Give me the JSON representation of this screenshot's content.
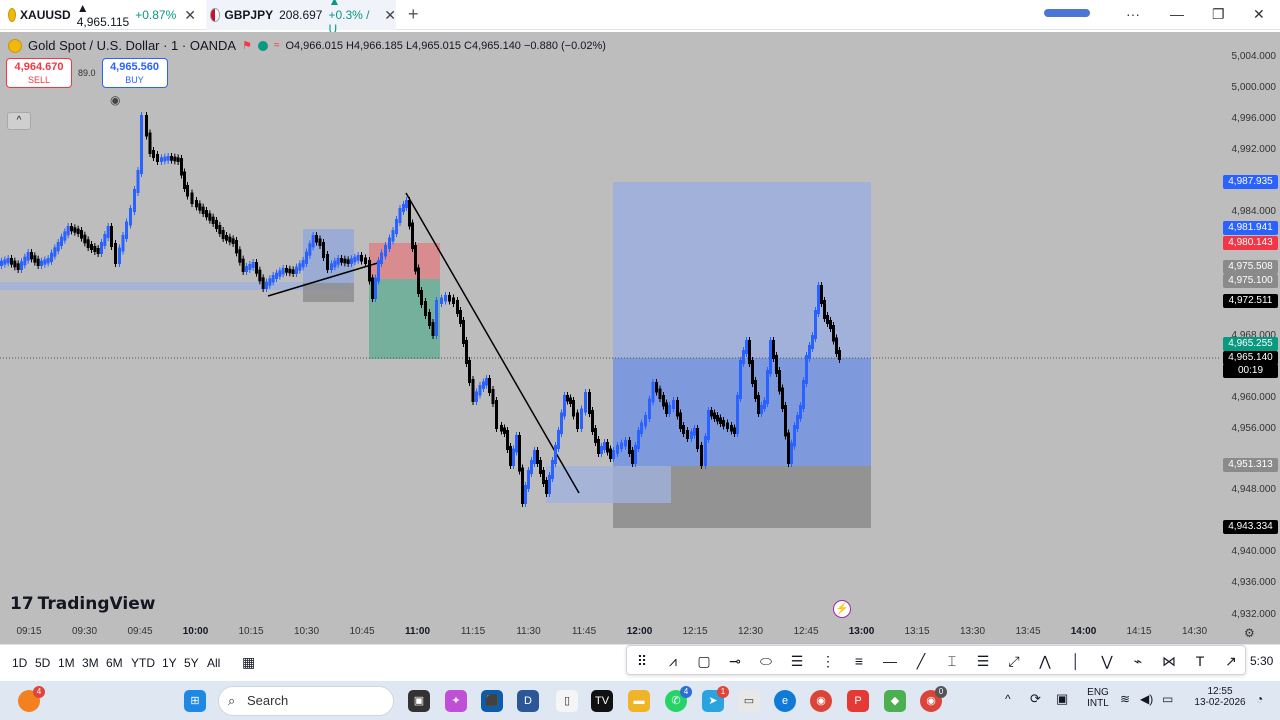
{
  "tabs": [
    {
      "symbol": "XAUUSD",
      "price": "▲ 4,965.115",
      "change": "+0.87%",
      "close": "✕",
      "icon": "gold-coin-icon"
    },
    {
      "symbol": "GBPJPY",
      "price": "208.697",
      "change": "▲ +0.3% / U",
      "close": "✕",
      "icon": "flag-icon"
    }
  ],
  "new_tab": "+",
  "window_controls": {
    "menu": "···",
    "minimize": "—",
    "restore": "❐",
    "close": "✕"
  },
  "legend": {
    "title": "Gold Spot / U.S. Dollar · 1 · OANDA",
    "ohlc": "O4,966.015  H4,966.185  L4,965.015  C4,965.140  −0.880 (−0.02%)"
  },
  "trade": {
    "sell_price": "4,964.670",
    "sell_label": "SELL",
    "spread": "89.0",
    "buy_price": "4,965.560",
    "buy_label": "BUY",
    "collapse": "^"
  },
  "logo": {
    "mark": "17",
    "text": "TradingView"
  },
  "price_axis": [
    "5,004.000",
    "5,000.000",
    "4,996.000",
    "4,992.000",
    "4,984.000",
    "4,968.000",
    "4,960.000",
    "4,956.000",
    "4,948.000",
    "4,940.000",
    "4,936.000",
    "4,932.000"
  ],
  "price_tags": [
    {
      "text": "4,987.935",
      "color": "#2962ff"
    },
    {
      "text": "4,981.941",
      "color": "#2962ff"
    },
    {
      "text": "4,980.143",
      "color": "#f23645"
    },
    {
      "text": "4,975.508",
      "color": "#8a8a8a"
    },
    {
      "text": "4,975.100",
      "color": "#8a8a8a"
    },
    {
      "text": "4,972.511",
      "color": "#000000"
    },
    {
      "text": "4,965.255",
      "color": "#089981"
    },
    {
      "text": "4,965.140",
      "color": "#000000"
    },
    {
      "text": "00:19",
      "color": "#000000"
    },
    {
      "text": "4,951.313",
      "color": "#8a8a8a"
    },
    {
      "text": "4,943.334",
      "color": "#000000"
    }
  ],
  "time_axis": [
    {
      "t": "09:15",
      "bold": false
    },
    {
      "t": "09:30",
      "bold": false
    },
    {
      "t": "09:45",
      "bold": false
    },
    {
      "t": "10:00",
      "bold": true
    },
    {
      "t": "10:15",
      "bold": false
    },
    {
      "t": "10:30",
      "bold": false
    },
    {
      "t": "10:45",
      "bold": false
    },
    {
      "t": "11:00",
      "bold": true
    },
    {
      "t": "11:15",
      "bold": false
    },
    {
      "t": "11:30",
      "bold": false
    },
    {
      "t": "11:45",
      "bold": false
    },
    {
      "t": "12:00",
      "bold": true
    },
    {
      "t": "12:15",
      "bold": false
    },
    {
      "t": "12:30",
      "bold": false
    },
    {
      "t": "12:45",
      "bold": false
    },
    {
      "t": "13:00",
      "bold": true
    },
    {
      "t": "13:15",
      "bold": false
    },
    {
      "t": "13:30",
      "bold": false
    },
    {
      "t": "13:45",
      "bold": false
    },
    {
      "t": "14:00",
      "bold": true
    },
    {
      "t": "14:15",
      "bold": false
    },
    {
      "t": "14:30",
      "bold": false
    }
  ],
  "ranges": [
    "1D",
    "5D",
    "1M",
    "3M",
    "6M",
    "YTD",
    "1Y",
    "5Y",
    "All"
  ],
  "bottom_clock": "5:30",
  "drawing_tools": [
    "⠿",
    "⩘",
    "▢",
    "⊸",
    "⬭",
    "☰",
    "⋮",
    "≡",
    "—",
    "╱",
    "⌶",
    "☰",
    "⤢",
    "⋀",
    "│",
    "⋁",
    "⌁",
    "⋈",
    "T",
    "↗"
  ],
  "taskbar": {
    "search_placeholder": "Search",
    "language": "ENG",
    "language_sub": "INTL",
    "time": "12:55",
    "date": "13-02-2026",
    "notif_badge": "4",
    "whatsapp_badge": "4",
    "telegram_badge": "1",
    "chrome2_badge": "0"
  },
  "colors": {
    "chart_bg": "#bdbdbd",
    "bull": "#2962ff",
    "bear": "#000000",
    "box_blue": "#7a98e0",
    "box_red": "#e57c80",
    "box_green": "#5aa88f"
  }
}
